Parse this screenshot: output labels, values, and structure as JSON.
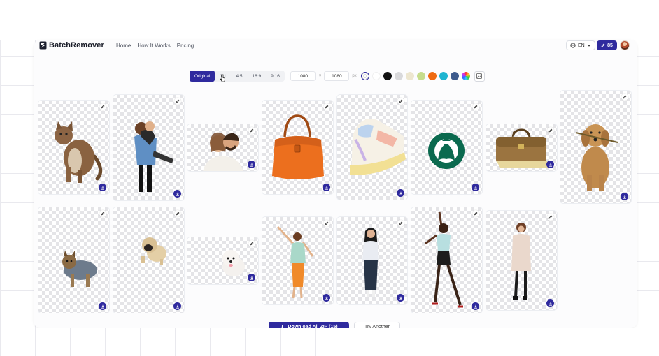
{
  "brand": {
    "name": "BatchRemover"
  },
  "nav": [
    {
      "label": "Home"
    },
    {
      "label": "How It Works"
    },
    {
      "label": "Pricing"
    }
  ],
  "header": {
    "language": "EN",
    "credits": "85"
  },
  "toolbar": {
    "ratios": [
      {
        "label": "Original",
        "active": true
      },
      {
        "label": "1:1",
        "active": false
      },
      {
        "label": "4:5",
        "active": false
      },
      {
        "label": "16:9",
        "active": false
      },
      {
        "label": "9:16",
        "active": false
      }
    ],
    "width": "1080",
    "times": "×",
    "height": "1080",
    "unit": "px",
    "swatches": [
      {
        "name": "transparent",
        "color": "transparent",
        "selected": true
      },
      {
        "name": "white",
        "color": "#ffffff"
      },
      {
        "name": "black",
        "color": "#111111"
      },
      {
        "name": "light-gray",
        "color": "#d9d9db"
      },
      {
        "name": "cream",
        "color": "#ede6cf"
      },
      {
        "name": "lime",
        "color": "#c7dd8c"
      },
      {
        "name": "orange",
        "color": "#ef6b12"
      },
      {
        "name": "cyan",
        "color": "#1fb5d1"
      },
      {
        "name": "slate-blue",
        "color": "#3d5a8c"
      },
      {
        "name": "rainbow",
        "color": "multicolor"
      }
    ]
  },
  "gallery": {
    "images": [
      {
        "subject": "cat"
      },
      {
        "subject": "couple-hug"
      },
      {
        "subject": "couple-selfie"
      },
      {
        "subject": "orange-handbag"
      },
      {
        "subject": "sneaker"
      },
      {
        "subject": "starbucks-logo"
      },
      {
        "subject": "leather-bag"
      },
      {
        "subject": "golden-retriever"
      },
      {
        "subject": "yorkie"
      },
      {
        "subject": "pug"
      },
      {
        "subject": "white-puppy"
      },
      {
        "subject": "dancing-woman"
      },
      {
        "subject": "standing-woman"
      },
      {
        "subject": "dancer"
      },
      {
        "subject": "woman-coat"
      }
    ]
  },
  "actions": {
    "download_zip": "Download All ZIP (15)",
    "try_another": "Try Another"
  },
  "colors": {
    "accent": "#2f2a9e",
    "checker": "#e4e4e7"
  }
}
